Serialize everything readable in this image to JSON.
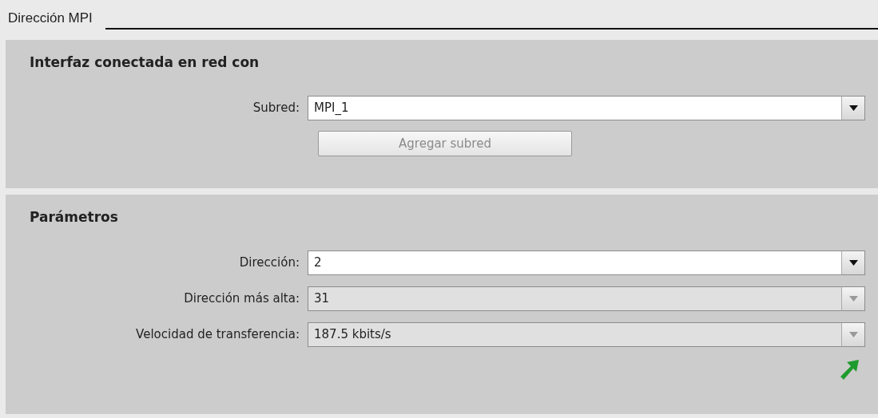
{
  "title": "Dirección MPI",
  "sections": [
    {
      "heading": "Interfaz conectada en red con",
      "fields": [
        {
          "label": "Subred:",
          "value": "MPI_1",
          "disabled": false
        }
      ],
      "button": {
        "label": "Agregar subred",
        "disabled": true
      }
    },
    {
      "heading": "Parámetros",
      "fields": [
        {
          "label": "Dirección:",
          "value": "2",
          "disabled": false
        },
        {
          "label": "Dirección más alta:",
          "value": "31",
          "disabled": true
        },
        {
          "label": "Velocidad de transferencia:",
          "value": "187.5 kbits/s",
          "disabled": true
        }
      ],
      "link_arrow": true
    }
  ]
}
